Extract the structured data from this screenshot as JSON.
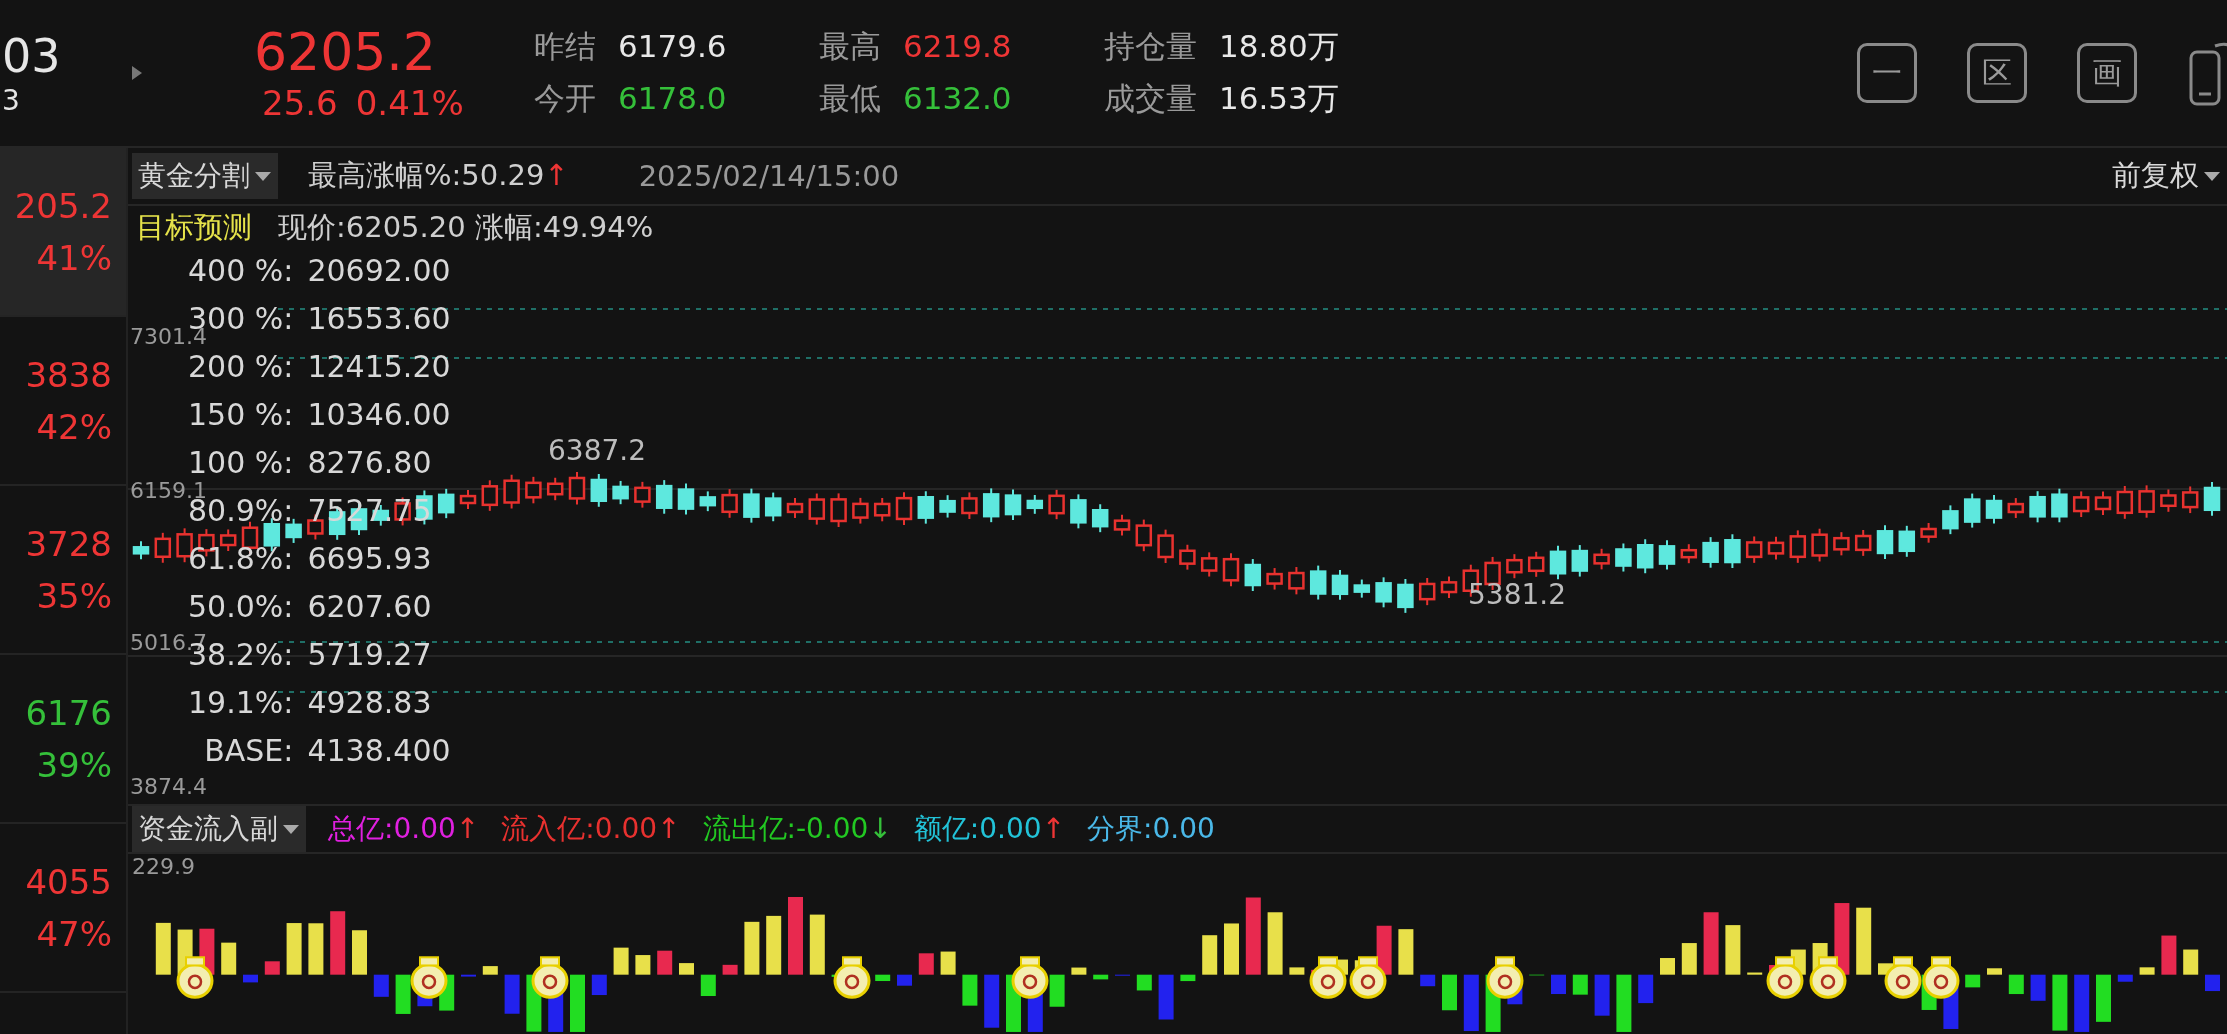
{
  "header": {
    "code_fragment": "03",
    "sub_fragment": "3",
    "price": "6205.2",
    "change": "25.6",
    "change_pct": "0.41%",
    "color": "#ee3535",
    "stats": [
      {
        "label": "昨结",
        "value": "6179.6",
        "color": "#e8e8e8"
      },
      {
        "label": "今开",
        "value": "6178.0",
        "color": "#35c03a"
      },
      {
        "label": "最高",
        "value": "6219.8",
        "color": "#ee3535"
      },
      {
        "label": "最低",
        "value": "6132.0",
        "color": "#35c03a"
      },
      {
        "label": "持仓量",
        "value": "18.80万",
        "color": "#e8e8e8"
      },
      {
        "label": "成交量",
        "value": "16.53万",
        "color": "#e8e8e8"
      }
    ],
    "tools": [
      {
        "kind": "glyph",
        "label": "一"
      },
      {
        "kind": "glyph",
        "label": "区"
      },
      {
        "kind": "glyph",
        "label": "画"
      },
      {
        "kind": "rotate"
      }
    ]
  },
  "watchlist": [
    {
      "value": "205.2",
      "pct": "41%",
      "color": "#ee3535",
      "selected": true
    },
    {
      "value": "3838",
      "pct": "42%",
      "color": "#ee3535",
      "selected": false
    },
    {
      "value": "3728",
      "pct": "35%",
      "color": "#ee3535",
      "selected": false
    },
    {
      "value": "6176",
      "pct": "39%",
      "color": "#35c03a",
      "selected": false
    },
    {
      "value": "4055",
      "pct": "47%",
      "color": "#ee3535",
      "selected": false
    }
  ],
  "main_chart": {
    "indicator": "黄金分割",
    "max_gain_label": "最高涨幅%:",
    "max_gain_value": "50.29",
    "max_gain_arrow": "↑",
    "date": "2025/02/14/15:00",
    "adjust": "前复权",
    "forecast_label": "目标预测",
    "current": "现价:6205.20 涨幅:49.94%",
    "y_labels": [
      "7301.4",
      "6159.1",
      "5016.7",
      "3874.4"
    ],
    "levels": [
      {
        "label": "400 %:",
        "value": "20692.00"
      },
      {
        "label": "300 %:",
        "value": "16553.60"
      },
      {
        "label": "200 %:",
        "value": "12415.20"
      },
      {
        "label": "150 %:",
        "value": "10346.00"
      },
      {
        "label": "100 %:",
        "value": "8276.80"
      },
      {
        "label": "80.9%:",
        "value": "7527.75"
      },
      {
        "label": "61.8%:",
        "value": "6695.93"
      },
      {
        "label": "50.0%:",
        "value": "6207.60"
      },
      {
        "label": "38.2%:",
        "value": "5719.27"
      },
      {
        "label": "19.1%:",
        "value": "4928.83"
      },
      {
        "label": "BASE:",
        "value": "4138.400"
      }
    ],
    "high_marker": "6387.2",
    "low_marker": "5381.2"
  },
  "sub_chart": {
    "indicator": "资金流入副",
    "y_label": "229.9",
    "metrics": [
      {
        "label": "总亿:",
        "value": "0.00",
        "arrow": "↑",
        "color": "#e020e0"
      },
      {
        "label": "流入亿:",
        "value": "0.00",
        "arrow": "↑",
        "color": "#e8312f"
      },
      {
        "label": "流出亿:",
        "value": "-0.00",
        "arrow": "↓",
        "color": "#22c822"
      },
      {
        "label": "额亿:",
        "value": "0.00",
        "arrow": "↑",
        "color": "#22c3d8"
      },
      {
        "label": "分界:",
        "value": "0.00",
        "color": "#4ab8e8"
      }
    ]
  }
}
